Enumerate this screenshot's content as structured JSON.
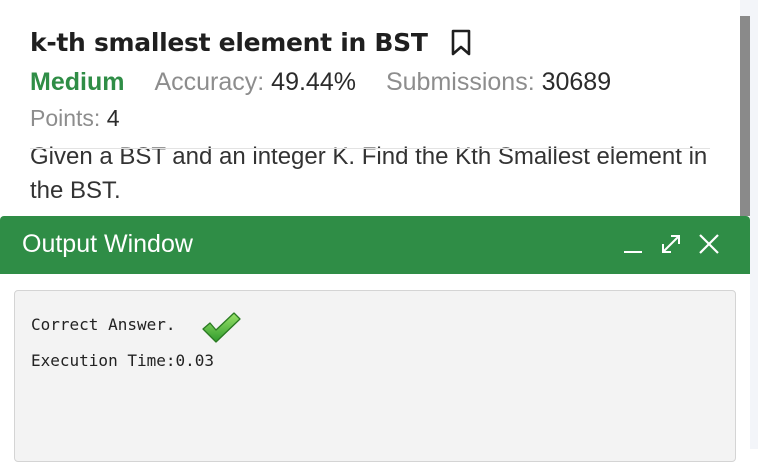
{
  "problem": {
    "title": "k-th smallest element in BST",
    "difficulty": "Medium",
    "accuracy_label": "Accuracy:",
    "accuracy_value": "49.44%",
    "submissions_label": "Submissions:",
    "submissions_value": "30689",
    "points_label": "Points:",
    "points_value": "4",
    "description": "Given a BST and an integer K. Find the Kth Smallest element in the BST."
  },
  "output_window": {
    "title": "Output Window",
    "result_text": "Correct Answer.",
    "execution_time": "Execution Time:0.03"
  },
  "icons": {
    "bookmark": "bookmark-icon",
    "minimize": "minimize-icon",
    "expand": "expand-icon",
    "close": "close-icon",
    "success": "checkmark-icon"
  },
  "colors": {
    "brand_green": "#2f8d46",
    "muted_text": "#8d8d8d",
    "output_bg": "#f3f3f3"
  }
}
